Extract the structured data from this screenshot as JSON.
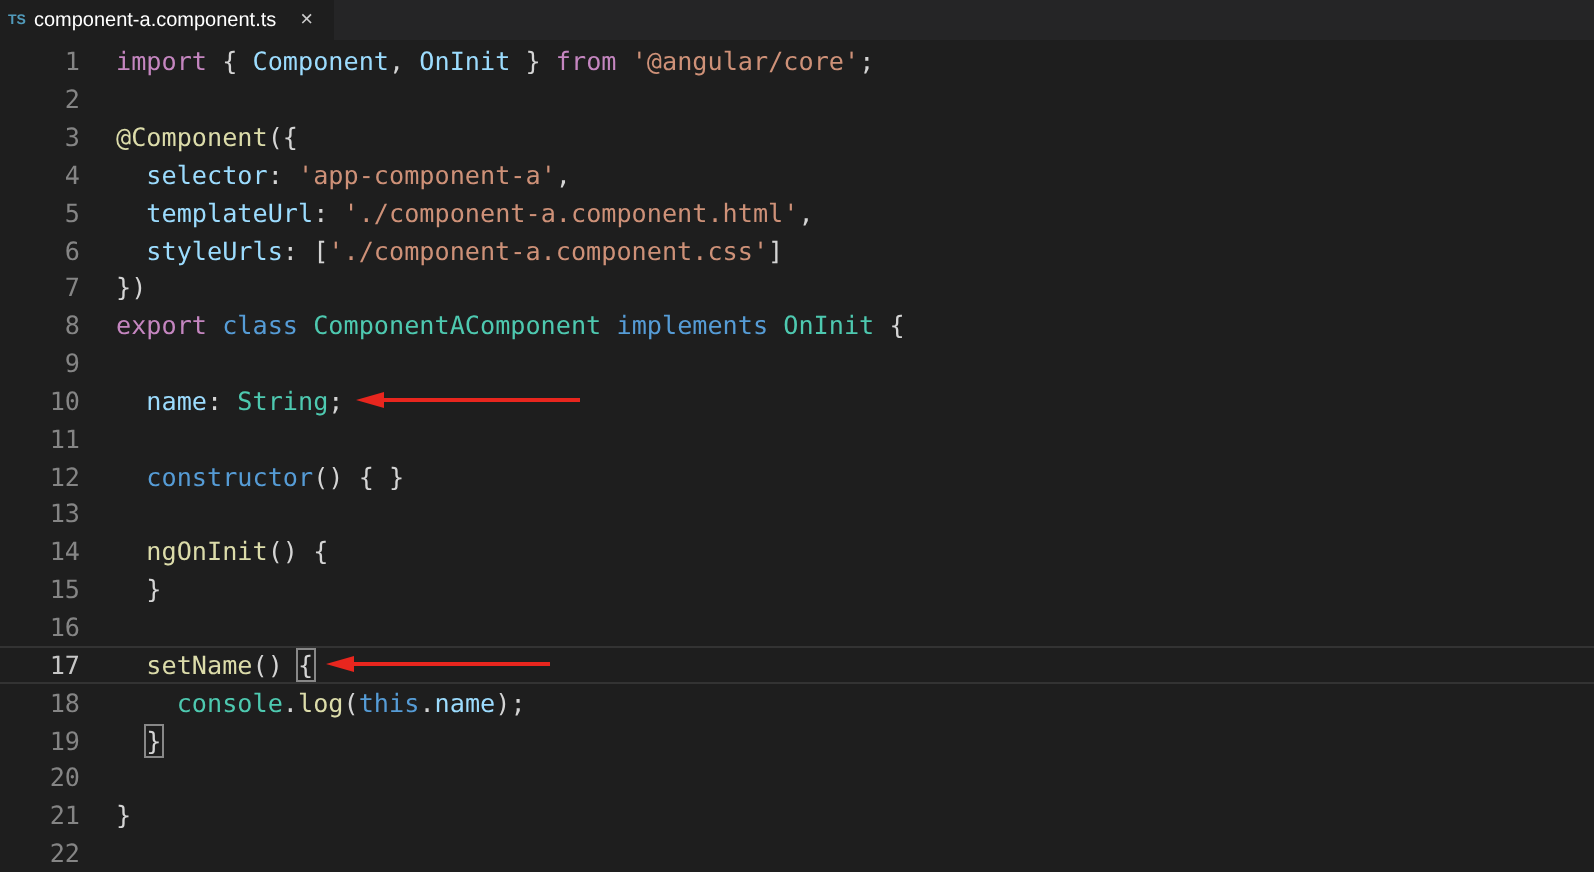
{
  "tabs": [
    {
      "icon": "TS",
      "label": "component-a.component.ts",
      "close": "×",
      "selected": true
    }
  ],
  "lines": [
    {
      "number": "1",
      "current": false,
      "arrow": false,
      "tokens": [
        {
          "t": "import",
          "kind": "keyword"
        },
        {
          "t": " { ",
          "kind": "punct"
        },
        {
          "t": "Component",
          "kind": "property"
        },
        {
          "t": ", ",
          "kind": "punct"
        },
        {
          "t": "OnInit",
          "kind": "property"
        },
        {
          "t": " } ",
          "kind": "punct"
        },
        {
          "t": "from ",
          "kind": "keyword"
        },
        {
          "t": "'@angular/core'",
          "kind": "string"
        },
        {
          "t": ";",
          "kind": "punct"
        }
      ]
    },
    {
      "number": "2",
      "current": false,
      "arrow": false
    },
    {
      "number": "3",
      "current": false,
      "arrow": false,
      "tokens": [
        {
          "t": "@Component",
          "kind": "function"
        },
        {
          "t": "({",
          "kind": "punct"
        }
      ]
    },
    {
      "number": "4",
      "current": false,
      "arrow": false,
      "tokens": [
        {
          "t": "  selector",
          "kind": "property"
        },
        {
          "t": ": ",
          "kind": "punct"
        },
        {
          "t": "'app-component-a'",
          "kind": "string"
        },
        {
          "t": ",",
          "kind": "punct"
        }
      ]
    },
    {
      "number": "5",
      "current": false,
      "arrow": false,
      "tokens": [
        {
          "t": "  templateUrl",
          "kind": "property"
        },
        {
          "t": ": ",
          "kind": "punct"
        },
        {
          "t": "'./component-a.component.html'",
          "kind": "string"
        },
        {
          "t": ",",
          "kind": "punct"
        }
      ]
    },
    {
      "number": "6",
      "current": false,
      "arrow": false,
      "tokens": [
        {
          "t": "  styleUrls",
          "kind": "property"
        },
        {
          "t": ": [",
          "kind": "punct"
        },
        {
          "t": "'./component-a.component.css'",
          "kind": "string"
        },
        {
          "t": "]",
          "kind": "punct"
        }
      ]
    },
    {
      "number": "7",
      "current": false,
      "arrow": false,
      "tokens": [
        {
          "t": "})",
          "kind": "punct"
        }
      ]
    },
    {
      "number": "8",
      "current": false,
      "arrow": false,
      "tokens": [
        {
          "t": "export ",
          "kind": "keyword"
        },
        {
          "t": "class ",
          "kind": "declaration"
        },
        {
          "t": "ComponentAComponent ",
          "kind": "type"
        },
        {
          "t": "implements ",
          "kind": "declaration"
        },
        {
          "t": "OnInit",
          "kind": "type"
        },
        {
          "t": " {",
          "kind": "punct"
        }
      ]
    },
    {
      "number": "9",
      "current": false,
      "arrow": false
    },
    {
      "number": "10",
      "current": false,
      "arrow": true,
      "tokens": [
        {
          "t": "  name",
          "kind": "property"
        },
        {
          "t": ": ",
          "kind": "punct"
        },
        {
          "t": "String",
          "kind": "type"
        },
        {
          "t": ";",
          "kind": "punct"
        }
      ]
    },
    {
      "number": "11",
      "current": false,
      "arrow": false
    },
    {
      "number": "12",
      "current": false,
      "arrow": false,
      "tokens": [
        {
          "t": "  constructor",
          "kind": "declaration"
        },
        {
          "t": "() { }",
          "kind": "punct"
        }
      ]
    },
    {
      "number": "13",
      "current": false,
      "arrow": false
    },
    {
      "number": "14",
      "current": false,
      "arrow": false,
      "tokens": [
        {
          "t": "  ngOnInit",
          "kind": "function"
        },
        {
          "t": "() {",
          "kind": "punct"
        }
      ]
    },
    {
      "number": "15",
      "current": false,
      "arrow": false,
      "tokens": [
        {
          "t": "  }",
          "kind": "punct"
        }
      ]
    },
    {
      "number": "16",
      "current": false,
      "arrow": false
    },
    {
      "number": "17",
      "current": true,
      "arrow": true,
      "tokens": [
        {
          "t": "  setName",
          "kind": "function"
        },
        {
          "t": "() ",
          "kind": "punct"
        },
        {
          "t": "{",
          "kind": "bracket"
        }
      ]
    },
    {
      "number": "18",
      "current": false,
      "arrow": false,
      "tokens": [
        {
          "t": "    console",
          "kind": "type"
        },
        {
          "t": ".",
          "kind": "punct"
        },
        {
          "t": "log",
          "kind": "function"
        },
        {
          "t": "(",
          "kind": "punct"
        },
        {
          "t": "this",
          "kind": "declaration"
        },
        {
          "t": ".",
          "kind": "punct"
        },
        {
          "t": "name",
          "kind": "property"
        },
        {
          "t": ");",
          "kind": "punct"
        }
      ]
    },
    {
      "number": "19",
      "current": false,
      "arrow": false,
      "tokens": [
        {
          "t": "  }",
          "kind": "bracket"
        }
      ]
    },
    {
      "number": "20",
      "current": false,
      "arrow": false
    },
    {
      "number": "21",
      "current": false,
      "arrow": false,
      "tokens": [
        {
          "t": "}",
          "kind": "punct"
        }
      ]
    },
    {
      "number": "22",
      "current": false,
      "arrow": false
    }
  ]
}
